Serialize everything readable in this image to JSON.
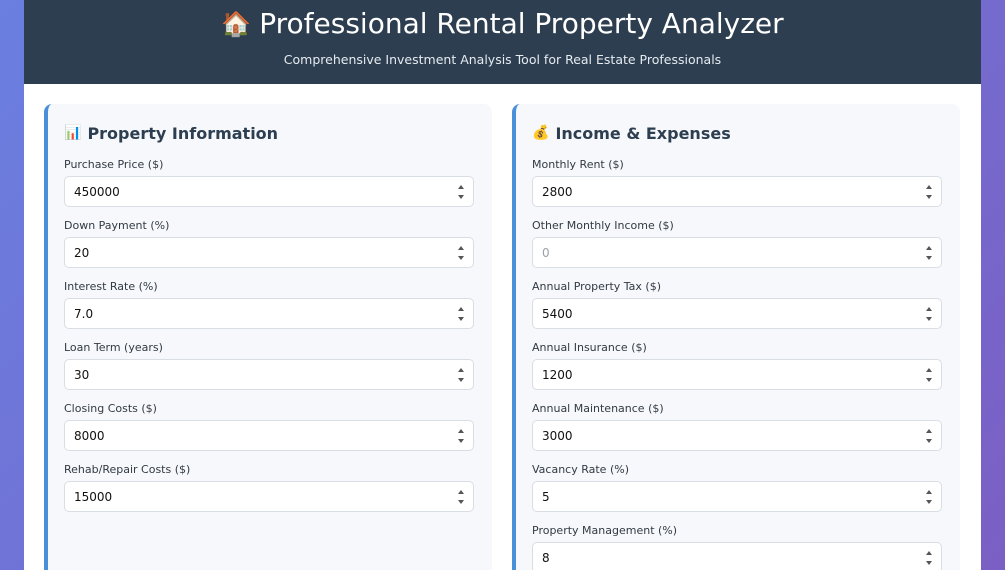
{
  "header": {
    "icon": "🏠",
    "title": "Professional Rental Property Analyzer",
    "subtitle": "Comprehensive Investment Analysis Tool for Real Estate Professionals"
  },
  "property": {
    "icon": "📊",
    "title": "Property Information",
    "fields": [
      {
        "label": "Purchase Price ($)",
        "value": "450000"
      },
      {
        "label": "Down Payment (%)",
        "value": "20"
      },
      {
        "label": "Interest Rate (%)",
        "value": "7.0"
      },
      {
        "label": "Loan Term (years)",
        "value": "30"
      },
      {
        "label": "Closing Costs ($)",
        "value": "8000"
      },
      {
        "label": "Rehab/Repair Costs ($)",
        "value": "15000"
      }
    ]
  },
  "income": {
    "icon": "💰",
    "title": "Income & Expenses",
    "fields": [
      {
        "label": "Monthly Rent ($)",
        "value": "2800"
      },
      {
        "label": "Other Monthly Income ($)",
        "value": "",
        "placeholder": "0"
      },
      {
        "label": "Annual Property Tax ($)",
        "value": "5400"
      },
      {
        "label": "Annual Insurance ($)",
        "value": "1200"
      },
      {
        "label": "Annual Maintenance ($)",
        "value": "3000"
      },
      {
        "label": "Vacancy Rate (%)",
        "value": "5"
      },
      {
        "label": "Property Management (%)",
        "value": "8"
      }
    ]
  }
}
